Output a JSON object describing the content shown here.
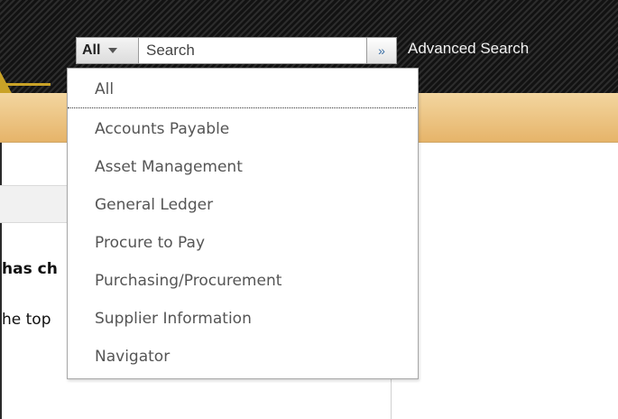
{
  "search": {
    "scope_label": "All",
    "placeholder": "Search",
    "go_glyph": "»",
    "advanced_label": "Advanced Search"
  },
  "background_text": {
    "line1": "has ch",
    "line2": "he top"
  },
  "dropdown": {
    "items": [
      {
        "label": "All",
        "selected": true
      },
      {
        "label": "Accounts Payable"
      },
      {
        "label": "Asset Management"
      },
      {
        "label": "General Ledger"
      },
      {
        "label": "Procure to Pay"
      },
      {
        "label": "Purchasing/Procurement"
      },
      {
        "label": "Supplier Information"
      },
      {
        "label": "Navigator"
      }
    ]
  },
  "colors": {
    "header_dark": "#141414",
    "accent_gold": "#c9a227",
    "band_gold": "#e6b46a",
    "menu_text": "#555555"
  }
}
